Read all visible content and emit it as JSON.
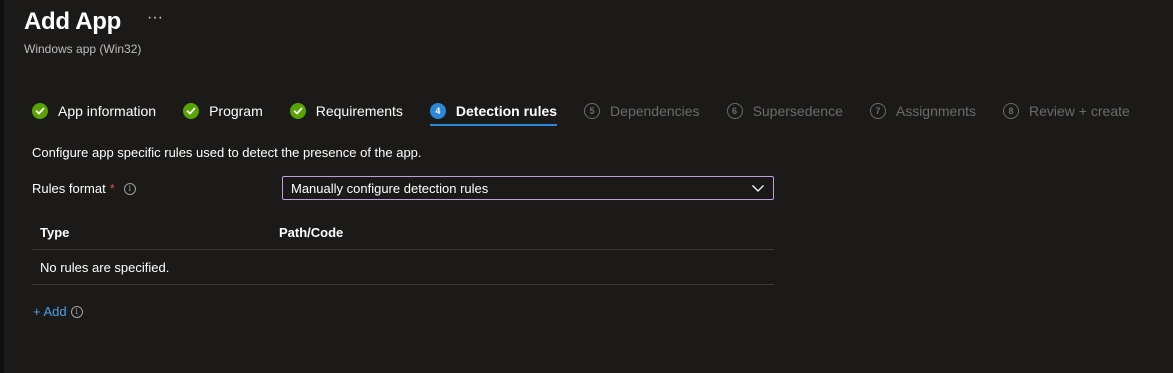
{
  "header": {
    "title": "Add App",
    "more": "···",
    "subtitle": "Windows app (Win32)"
  },
  "wizard": {
    "steps": [
      {
        "number": "1",
        "label": "App information",
        "state": "done"
      },
      {
        "number": "2",
        "label": "Program",
        "state": "done"
      },
      {
        "number": "3",
        "label": "Requirements",
        "state": "done"
      },
      {
        "number": "4",
        "label": "Detection rules",
        "state": "current"
      },
      {
        "number": "5",
        "label": "Dependencies",
        "state": "pending"
      },
      {
        "number": "6",
        "label": "Supersedence",
        "state": "pending"
      },
      {
        "number": "7",
        "label": "Assignments",
        "state": "pending"
      },
      {
        "number": "8",
        "label": "Review + create",
        "state": "pending"
      }
    ]
  },
  "description": "Configure app specific rules used to detect the presence of the app.",
  "rules_format": {
    "label": "Rules format",
    "required_marker": "*",
    "info_glyph": "i",
    "value": "Manually configure detection rules"
  },
  "table": {
    "columns": [
      "Type",
      "Path/Code"
    ],
    "empty_text": "No rules are specified."
  },
  "add_link": {
    "label": "+ Add",
    "info_glyph": "i"
  },
  "colors": {
    "background": "#1b1a19",
    "accent": "#2b88d8",
    "success": "#57a300",
    "link": "#4ca0e8",
    "select_border": "#c39be8",
    "required": "#e8484a"
  }
}
